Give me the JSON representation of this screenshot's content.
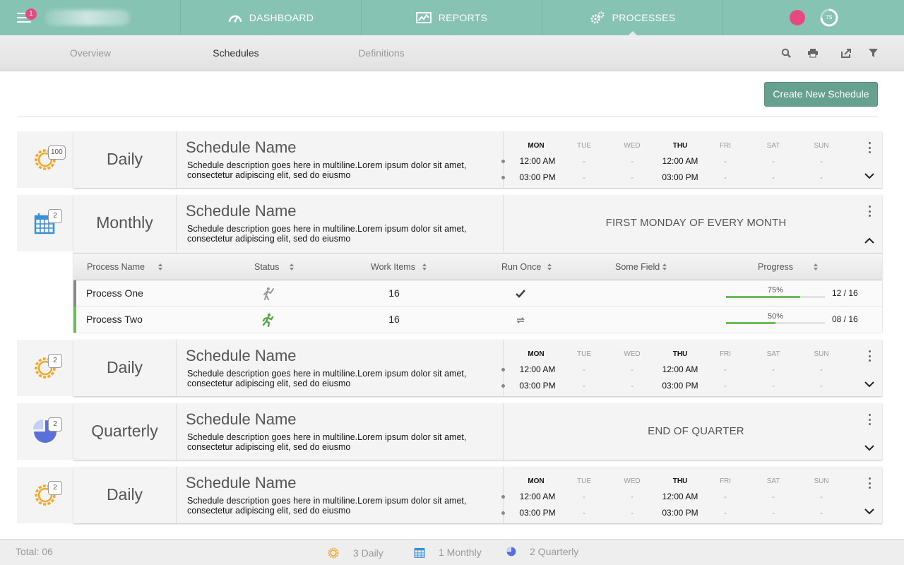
{
  "nav": {
    "notification_count": "1",
    "tabs": [
      {
        "label": "DASHBOARD",
        "icon": "speedometer-icon"
      },
      {
        "label": "REPORTS",
        "icon": "chart-icon"
      },
      {
        "label": "PROCESSES",
        "icon": "gears-icon",
        "active": true
      }
    ],
    "timer_value": "75"
  },
  "subnav": {
    "tabs": [
      {
        "label": "Overview",
        "active": false
      },
      {
        "label": "Schedules",
        "active": true
      },
      {
        "label": "Definitions",
        "active": false
      }
    ],
    "tools": [
      "search-icon",
      "print-icon",
      "export-icon",
      "filter-icon"
    ]
  },
  "create_button": "Create New Schedule",
  "days": [
    "MON",
    "TUE",
    "WED",
    "THU",
    "FRI",
    "SAT",
    "SUN"
  ],
  "schedules": [
    {
      "type": "Daily",
      "icon": "sun-icon",
      "count": "100",
      "name": "Schedule Name",
      "description": "Schedule description goes here in multiline.Lorem ipsum dolor sit amet, consectetur adipiscing elit, sed do eiusmo",
      "times": [
        [
          "12:00 AM",
          "-",
          "-",
          "12:00 AM",
          "-",
          "-",
          "-"
        ],
        [
          "03:00 PM",
          "-",
          "-",
          "03:00 PM",
          "-",
          "-",
          "-"
        ]
      ]
    },
    {
      "type": "Monthly",
      "icon": "calendar-icon",
      "count": "2",
      "name": "Schedule Name",
      "description": "Schedule description goes here in multiline.Lorem ipsum dolor sit amet, consectetur adipiscing elit, sed do eiusmo",
      "banner": "FIRST MONDAY OF EVERY MONTH",
      "expanded": true
    },
    {
      "type": "Daily",
      "icon": "sun-icon",
      "count": "2",
      "name": "Schedule Name",
      "description": "Schedule description goes here in multiline.Lorem ipsum dolor sit amet, consectetur adipiscing elit, sed do eiusmo",
      "times": [
        [
          "12:00 AM",
          "-",
          "-",
          "12:00 AM",
          "-",
          "-",
          "-"
        ],
        [
          "03:00 PM",
          "-",
          "-",
          "03:00 PM",
          "-",
          "-",
          "-"
        ]
      ]
    },
    {
      "type": "Quarterly",
      "icon": "pie-icon",
      "count": "2",
      "name": "Schedule Name",
      "description": "Schedule description goes here in multiline.Lorem ipsum dolor sit amet, consectetur adipiscing elit, sed do eiusmo",
      "banner": "END OF QUARTER"
    },
    {
      "type": "Daily",
      "icon": "sun-icon",
      "count": "2",
      "name": "Schedule Name",
      "description": "Schedule description goes here in multiline.Lorem ipsum dolor sit amet, consectetur adipiscing elit, sed do eiusmo",
      "times": [
        [
          "12:00 AM",
          "-",
          "-",
          "12:00 AM",
          "-",
          "-",
          "-"
        ],
        [
          "03:00 PM",
          "-",
          "-",
          "03:00 PM",
          "-",
          "-",
          "-"
        ]
      ]
    }
  ],
  "process_table": {
    "headers": [
      "Process Name",
      "Status",
      "Work Items",
      "Run Once",
      "Some Field",
      "Progress"
    ],
    "rows": [
      {
        "name": "Process One",
        "status_icon": "idle-person-icon",
        "work_items": "16",
        "run_once_icon": "checkmark-icon",
        "progress_pct": "75%",
        "progress": 0.75,
        "count": "12 / 16",
        "accent": "#888888"
      },
      {
        "name": "Process Two",
        "status_icon": "running-person-icon",
        "work_items": "16",
        "run_once_icon": "repeat-icon",
        "progress_pct": "50%",
        "progress": 0.5,
        "count": "08 / 16",
        "accent": "#6dba5b"
      }
    ]
  },
  "footer": {
    "total": "Total: 06",
    "items": [
      {
        "label": "3 Daily",
        "icon": "sun-icon"
      },
      {
        "label": "1 Monthly",
        "icon": "calendar-icon"
      },
      {
        "label": "2 Quarterly",
        "icon": "pie-icon"
      }
    ]
  },
  "colors": {
    "nav": "#86c3b3",
    "accent": "#66a08f",
    "sun": "#f0a830",
    "calendar": "#3b8fd6",
    "pie": "#5b6fd8",
    "progress": "#6dba5b",
    "badge": "#e7487d"
  }
}
